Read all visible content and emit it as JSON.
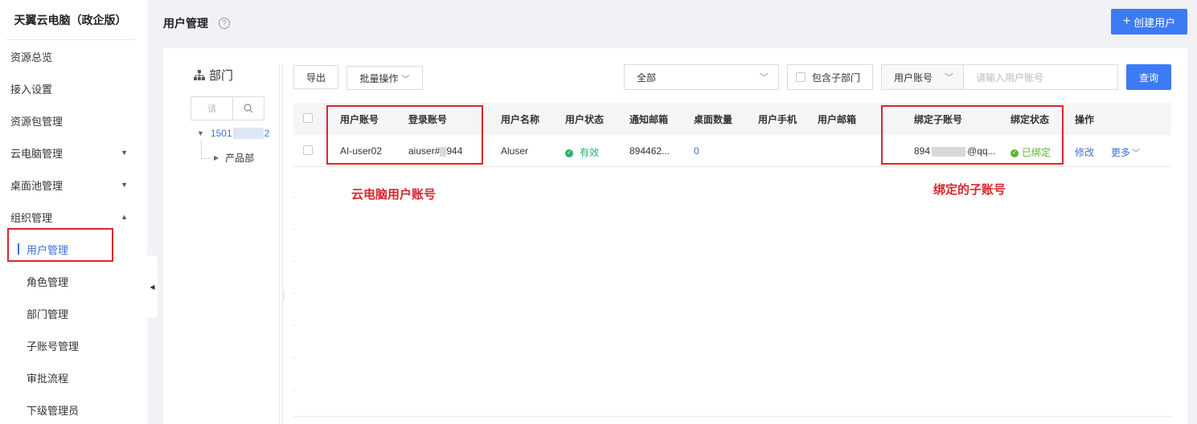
{
  "sidebar": {
    "brand": "天翼云电脑（政企版）",
    "items": [
      {
        "label": "资源总览"
      },
      {
        "label": "接入设置"
      },
      {
        "label": "资源包管理"
      },
      {
        "label": "云电脑管理"
      },
      {
        "label": "桌面池管理"
      },
      {
        "label": "组织管理"
      },
      {
        "label": "用户管理"
      },
      {
        "label": "角色管理"
      },
      {
        "label": "部门管理"
      },
      {
        "label": "子账号管理"
      },
      {
        "label": "审批流程"
      },
      {
        "label": "下级管理员"
      }
    ]
  },
  "header": {
    "title": "用户管理",
    "help": "?",
    "create_label": "创建用户"
  },
  "dept": {
    "title": "部门",
    "search_placeholder": "请",
    "root_prefix": "1501",
    "root_suffix": "2",
    "child": "产品部"
  },
  "toolbar": {
    "export": "导出",
    "batch": "批量操作",
    "filter_value": "全部",
    "include_sub": "包含子部门",
    "field_select": "用户账号",
    "search_placeholder": "请输入用户账号",
    "query": "查询"
  },
  "table": {
    "headers": {
      "account": "用户账号",
      "login": "登录账号",
      "name": "用户名称",
      "status": "用户状态",
      "notify_email": "通知邮箱",
      "desktops": "桌面数量",
      "phone": "用户手机",
      "email": "用户邮箱",
      "sub_account": "绑定子账号",
      "bind_status": "绑定状态",
      "actions": "操作"
    },
    "row": {
      "account": "AI-user02",
      "login_prefix": "aiuser#",
      "login_suffix": "944",
      "name": "Aluser",
      "status": "有效",
      "notify_email": "894462...",
      "desktops": "0",
      "phone": "",
      "email": "",
      "sub_account_prefix": "894",
      "sub_account_suffix": "@qq...",
      "bind_status": "已绑定",
      "edit": "修改",
      "more": "更多"
    }
  },
  "annotations": {
    "account_note": "云电脑用户账号",
    "sub_account_note": "绑定的子账号"
  },
  "colors": {
    "primary": "#3d7bf5",
    "annotation": "#d9262c",
    "success": "#23b26d"
  }
}
